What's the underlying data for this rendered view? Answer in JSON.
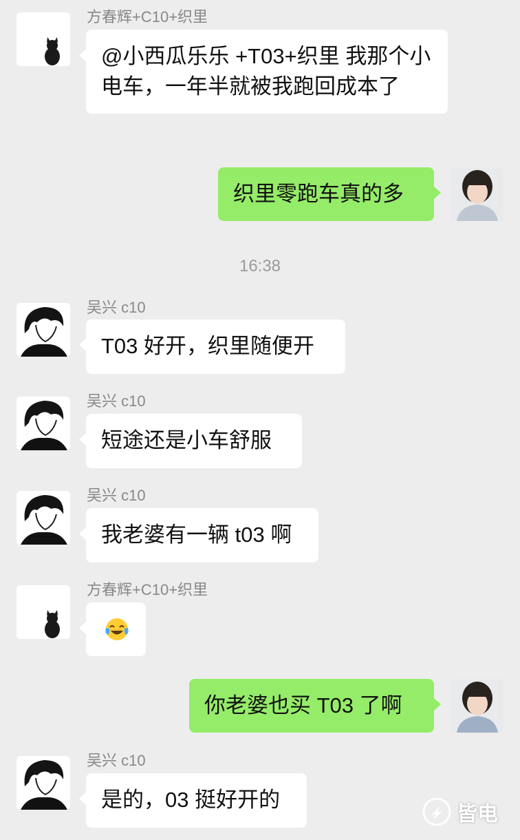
{
  "time_divider": "16:38",
  "senders": {
    "fang": "方春辉+C10+织里",
    "wu": "吴兴 c10"
  },
  "messages": [
    {
      "text": "@小西瓜乐乐 +T03+织里 我那个小电车，一年半就被我跑回成本了"
    },
    {
      "text": "织里零跑车真的多"
    },
    {
      "text": "T03 好开，织里随便开"
    },
    {
      "text": "短途还是小车舒服"
    },
    {
      "text": "我老婆有一辆 t03 啊"
    },
    {
      "text": "",
      "emoji": "crying-laughing-emoji"
    },
    {
      "text": "你老婆也买 T03 了啊"
    },
    {
      "text": "是的，03 挺好开的"
    }
  ],
  "watermark": {
    "text": "皆电",
    "icon": "logo-icon"
  },
  "colors": {
    "background": "#ededed",
    "outgoing_bubble": "#95ec69",
    "incoming_bubble": "#ffffff",
    "meta_text": "#888888"
  }
}
